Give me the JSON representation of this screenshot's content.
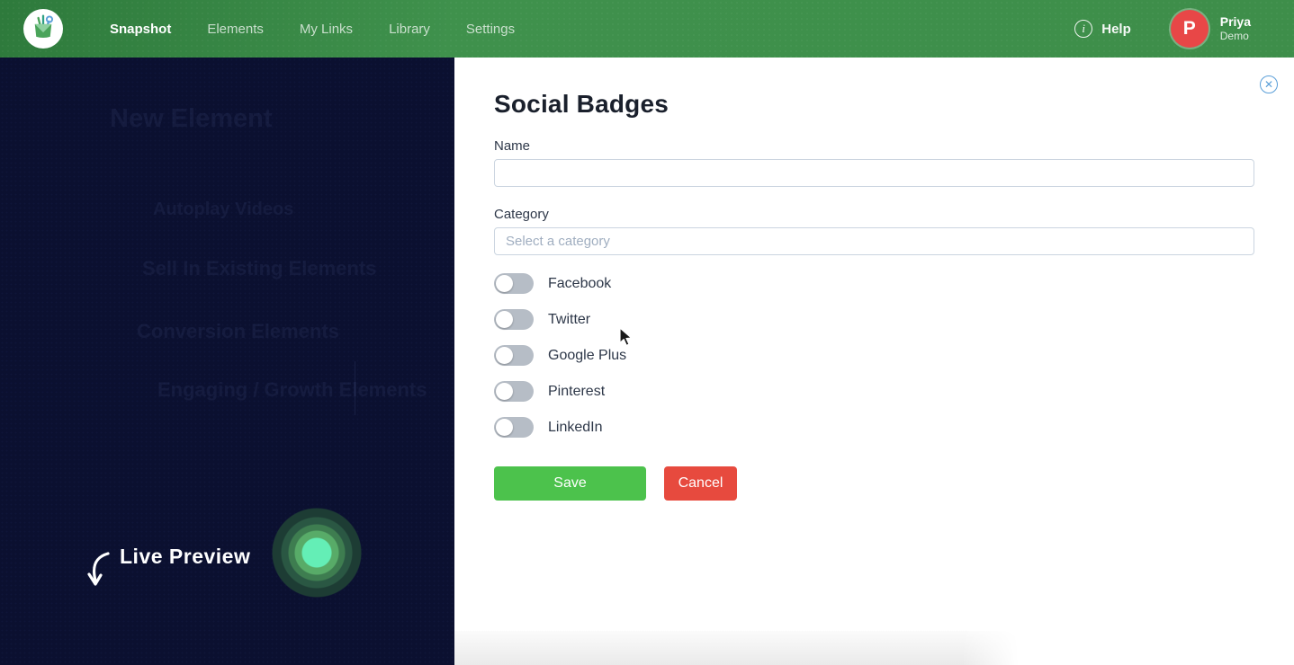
{
  "navbar": {
    "logo": "toolbox-logo",
    "items": [
      {
        "label": "Snapshot",
        "active": true
      },
      {
        "label": "Elements",
        "active": false
      },
      {
        "label": "My Links",
        "active": false
      },
      {
        "label": "Library",
        "active": false
      },
      {
        "label": "Settings",
        "active": false
      }
    ],
    "help": {
      "icon": "info-icon",
      "label": "Help"
    },
    "user": {
      "initial": "P",
      "first_name": "Priya",
      "last_name": "Demo"
    }
  },
  "sidebar": {
    "ghost_title": "New Element",
    "ghost_lines": [
      "Autoplay Videos",
      "Sell In Existing Elements",
      "Conversion Elements",
      "Engaging / Growth Elements"
    ],
    "live_preview_label": "Live Preview"
  },
  "panel": {
    "title": "Social Badges",
    "close_icon": "✕",
    "name_label": "Name",
    "name_value": "",
    "category_label": "Category",
    "category_placeholder": "Select a category",
    "toggles": [
      {
        "label": "Facebook",
        "state": "off"
      },
      {
        "label": "Twitter",
        "state": "off"
      },
      {
        "label": "Google Plus",
        "state": "off"
      },
      {
        "label": "Pinterest",
        "state": "off"
      },
      {
        "label": "LinkedIn",
        "state": "off"
      }
    ],
    "save_label": "Save",
    "cancel_label": "Cancel"
  },
  "colors": {
    "navbar_green": "#3e8e4a",
    "sidebar_navy": "#0b1030",
    "save_green": "#4cc24c",
    "cancel_red": "#e74a3e",
    "close_blue": "#5b9fd8",
    "avatar_red": "#e84747",
    "glow_mint": "#64eeb6",
    "toggle_track_gray": "#b6bdc6"
  }
}
